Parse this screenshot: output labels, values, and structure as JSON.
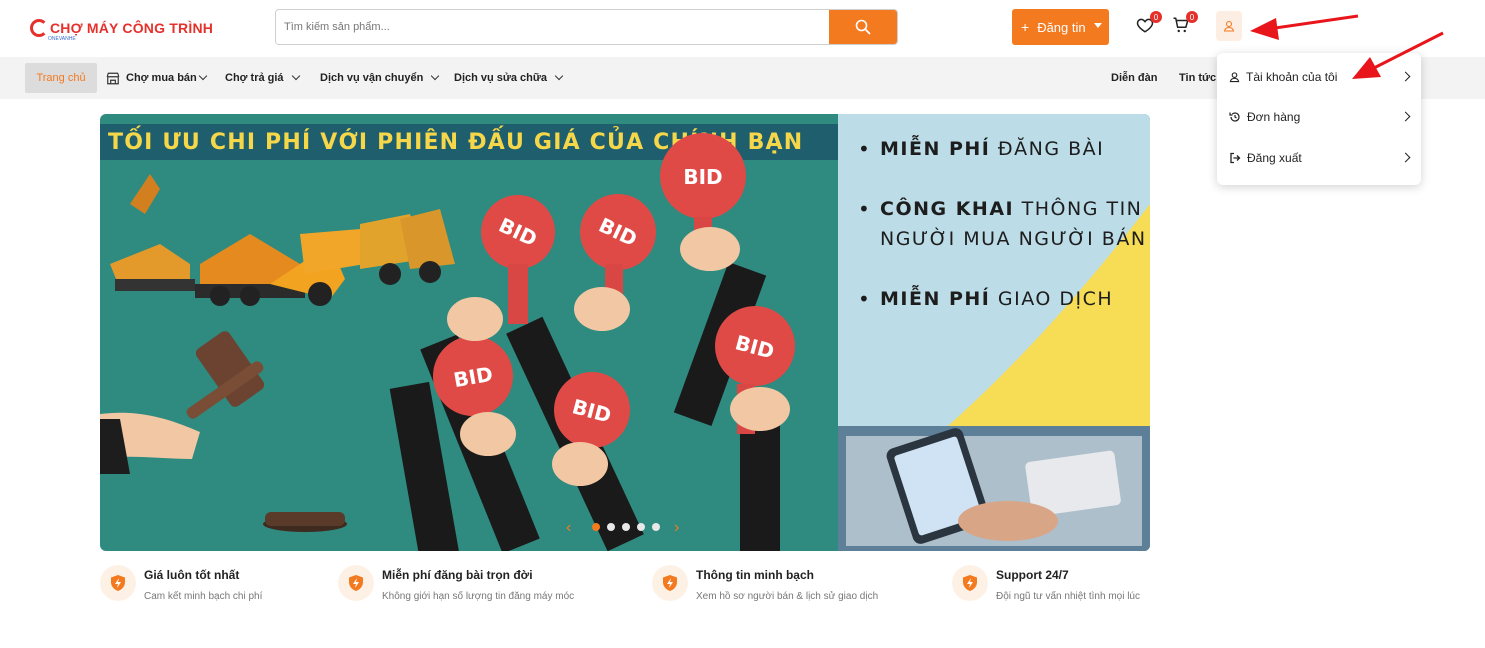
{
  "header": {
    "logo_text": "CHỢ MÁY CÔNG TRÌNH",
    "logo_sub": "ONEVANHE",
    "search_placeholder": "Tìm kiếm sản phẩm...",
    "post_button_label": "Đăng tin",
    "wishlist_count": "0",
    "cart_count": "0",
    "accent_color": "#f47a20"
  },
  "nav": {
    "items": [
      {
        "label": "Trang chủ"
      },
      {
        "label": "Chợ mua bán"
      },
      {
        "label": "Chợ trả giá"
      },
      {
        "label": "Dịch vụ vận chuyển"
      },
      {
        "label": "Dịch vụ sửa chữa"
      }
    ],
    "right_items": [
      {
        "label": "Diễn đàn"
      },
      {
        "label": "Tin tức"
      }
    ]
  },
  "banner": {
    "headline": "TỐI ƯU CHI PHÍ VỚI PHIÊN ĐẤU GIÁ CỦA CHÍNH BẠN",
    "bid_sign_text": "BID",
    "bullets": [
      {
        "bold": "MIỄN PHÍ",
        "rest": " ĐĂNG BÀI"
      },
      {
        "bold": "CÔNG KHAI",
        "rest": " THÔNG TIN NGƯỜI MUA NGƯỜI BÁN"
      },
      {
        "bold": "MIỄN PHÍ",
        "rest": " GIAO DỊCH"
      }
    ],
    "carousel": {
      "total_slides": 5,
      "active_slide": 1
    }
  },
  "features": [
    {
      "title": "Giá luôn tốt nhất",
      "desc": "Cam kết minh bạch chi phí"
    },
    {
      "title": "Miễn phí đăng bài trọn đời",
      "desc": "Không giới hạn số lượng tin đăng máy móc"
    },
    {
      "title": "Thông tin minh bạch",
      "desc": "Xem hồ sơ người bán & lịch sử giao dịch"
    },
    {
      "title": "Support 24/7",
      "desc": "Đội ngũ tư vấn nhiệt tình mọi lúc"
    }
  ],
  "account_menu": {
    "items": [
      {
        "label": "Tài khoản của tôi",
        "icon": "user-icon"
      },
      {
        "label": "Đơn hàng",
        "icon": "history-icon"
      },
      {
        "label": "Đăng xuất",
        "icon": "logout-icon"
      }
    ]
  },
  "annotation": {
    "arrow_color": "#e8151b"
  }
}
